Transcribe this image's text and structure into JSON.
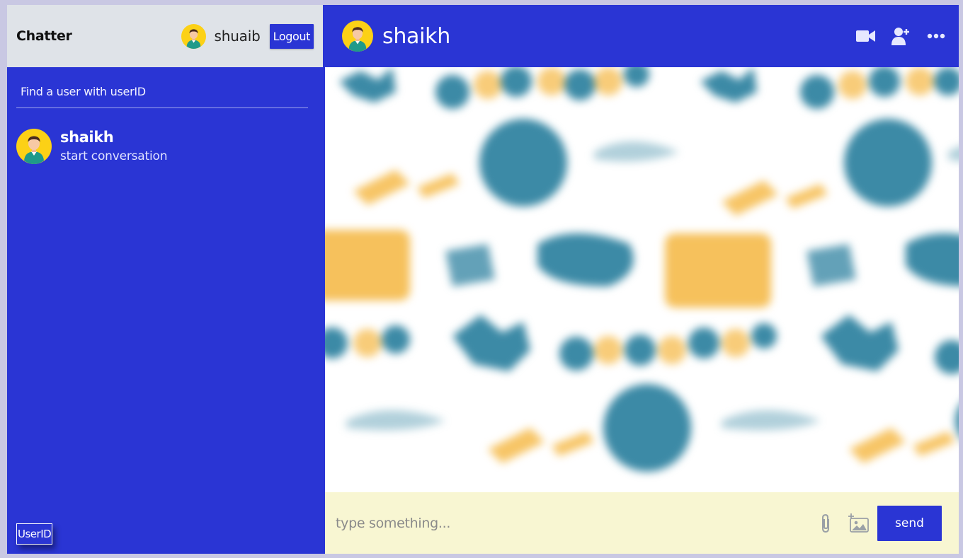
{
  "colors": {
    "primary": "#2a35d4",
    "sidebar_header_bg": "#dfe3e8",
    "input_bar_bg": "#f8f6d2",
    "page_bg": "#c9c8e3",
    "avatar_yellow": "#fcd116",
    "pattern_teal": "#3c8aa6",
    "pattern_orange": "#f5b640"
  },
  "sidebar": {
    "brand": "Chatter",
    "current_user": {
      "name": "shuaib",
      "avatar_icon": "user-avatar-icon"
    },
    "logout_label": "Logout",
    "search": {
      "placeholder": "Find a user with userID",
      "value": ""
    },
    "conversations": [
      {
        "name": "shaikh",
        "last_message": "start conversation",
        "avatar_icon": "user-avatar-icon"
      }
    ],
    "userid_button_label": "UserID"
  },
  "chat": {
    "peer_name": "shaikh",
    "peer_avatar_icon": "user-avatar-icon",
    "header_actions": [
      "video-camera-icon",
      "add-user-icon",
      "more-options-icon"
    ],
    "background": "blurred-greeting-pattern",
    "input": {
      "placeholder": "type something...",
      "value": ""
    },
    "attach_icon": "paperclip-icon",
    "image_icon": "add-image-icon",
    "send_label": "send"
  }
}
